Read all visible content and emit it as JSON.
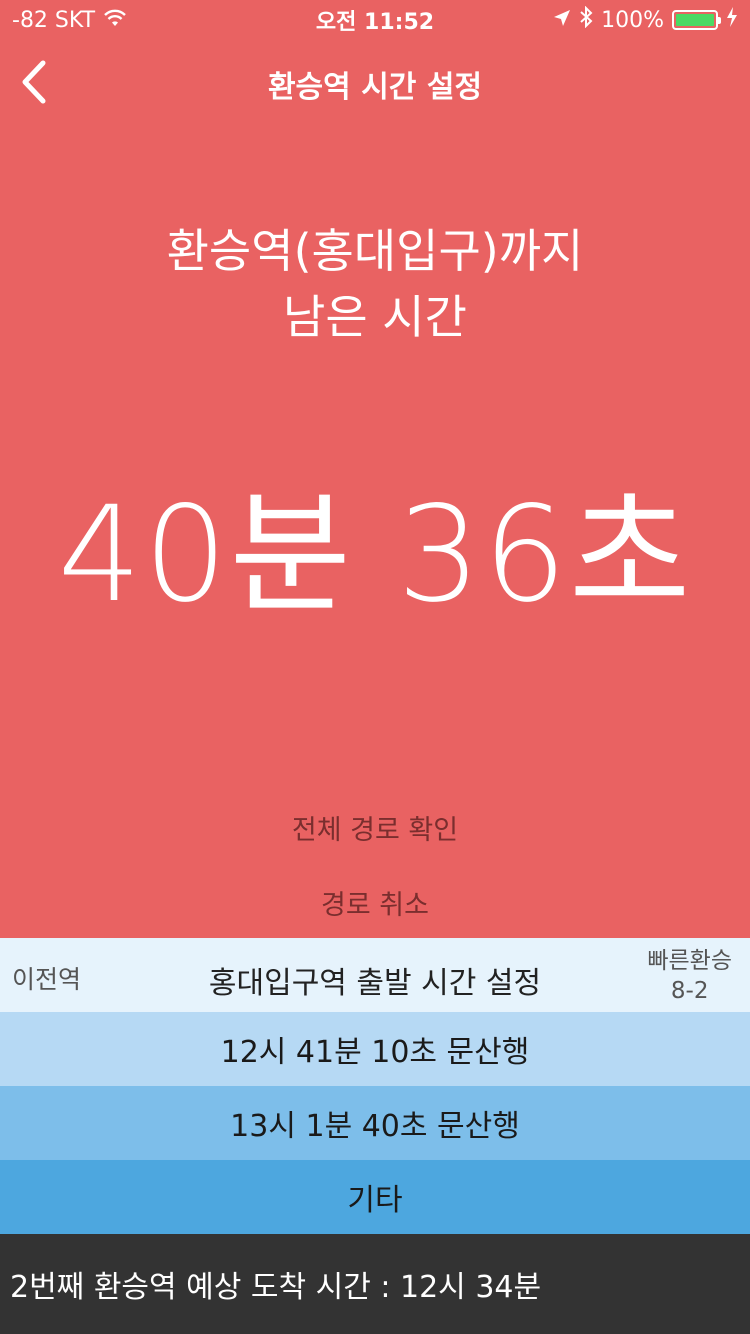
{
  "status_bar": {
    "signal": "-82 SKT",
    "time": "오전 11:52",
    "battery": "100%",
    "battery_level": 1.0
  },
  "nav": {
    "title": "환승역 시간 설정",
    "back_icon": "chevron-left-icon"
  },
  "headline": {
    "line1": "환승역(홍대입구)까지",
    "line2": "남은 시간"
  },
  "countdown": "40분 36초",
  "links": {
    "route_check": "전체 경로 확인",
    "route_cancel": "경로 취소"
  },
  "departure_panel": {
    "prev_station": "이전역",
    "title": "홍대입구역 출발 시간 설정",
    "fast_transfer_label": "빠른환승",
    "fast_transfer_value": "8-2",
    "options": [
      "12시 41분 10초 문산행",
      "13시 1분 40초 문산행",
      "기타"
    ]
  },
  "footer": {
    "text": "2번째 환승역 예상 도착 시간 : 12시 34분"
  },
  "colors": {
    "background": "#e96262",
    "panel_header": "#e6f3fc",
    "option_1": "#b6d9f4",
    "option_2": "#7dbeea",
    "option_3": "#4da7df",
    "footer": "#333333",
    "battery_fill": "#4cd964"
  }
}
